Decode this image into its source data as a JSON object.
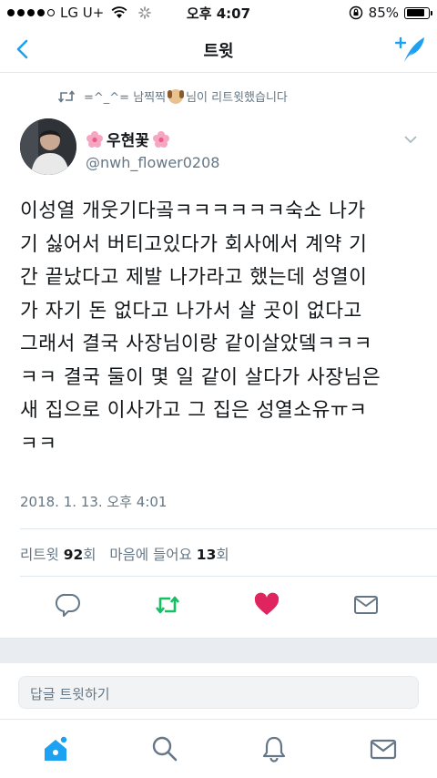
{
  "status_bar": {
    "carrier": "LG U+",
    "time": "오후 4:07",
    "battery": "85%",
    "battery_level": 0.85
  },
  "nav": {
    "title": "트윗",
    "back_icon": "chevron-left-icon",
    "compose_icon": "compose-tweet-icon"
  },
  "retweet_header": {
    "prefix": "=^_^= 남찍찍",
    "suffix": "님이 리트윗했습니다"
  },
  "author": {
    "name": "우현꽃",
    "handle": "@nwh_flower0208"
  },
  "tweet": {
    "text": "이성열 개웃기다곸ㅋㅋㅋㅋㅋㅋ숙소 나가\n기 싫어서 버티고있다가 회사에서 계약 기\n간 끝났다고 제발 나가라고 했는데 성열이\n가 자기 돈 없다고 나가서 살 곳이 없다고\n그래서 결국 사장님이랑 같이살았뎈ㅋㅋㅋ\nㅋㅋ 결국 둘이 몇 일 같이 살다가 사장님은\n새 집으로 이사가고 그 집은 성열소유ㅠㅋ\nㅋㅋ",
    "date": "2018. 1. 13. 오후 4:01"
  },
  "stats": {
    "retweet_label": "리트윗",
    "retweet_count": "92",
    "retweet_unit": "회",
    "like_label": "마음에 들어요",
    "like_count": "13",
    "like_unit": "회"
  },
  "reply": {
    "placeholder": "답글 트윗하기"
  },
  "colors": {
    "accent": "#1da1f2",
    "retweet_green": "#17bf63",
    "like_red": "#e0245e",
    "secondary_text": "#657786"
  }
}
